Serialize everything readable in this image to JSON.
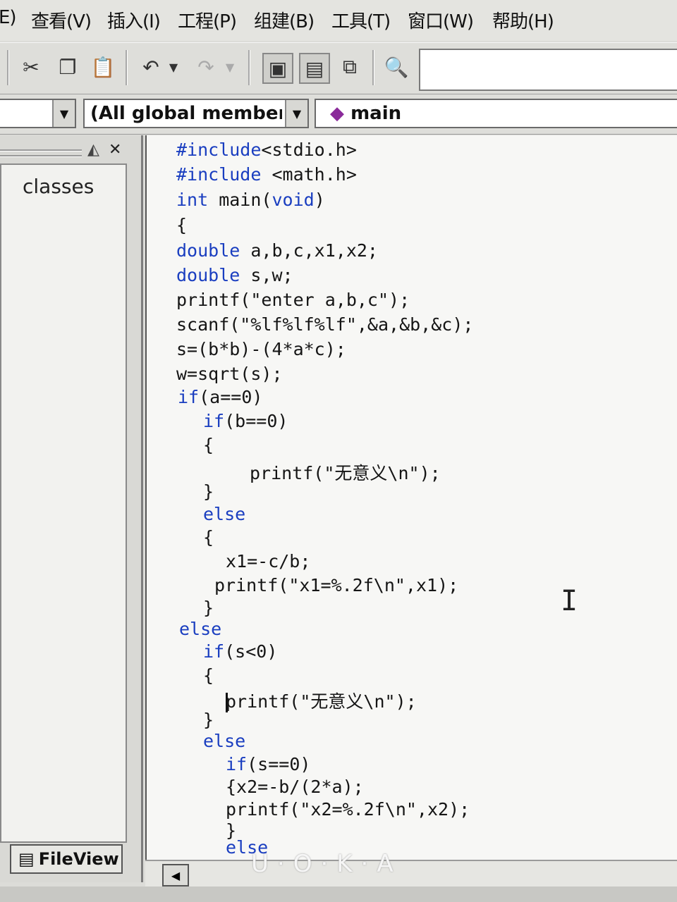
{
  "menu": {
    "items": [
      "E)",
      "查看(V)",
      "插入(I)",
      "工程(P)",
      "组建(B)",
      "工具(T)",
      "窗口(W)",
      "帮助(H)"
    ]
  },
  "toolbar": {
    "icons": [
      "cut-icon",
      "copy-icon",
      "paste-icon",
      "undo-icon",
      "redo-icon",
      "workspace-icon",
      "output-icon",
      "window-list-icon",
      "find-in-files-icon"
    ],
    "search_value": ""
  },
  "wizard_bar": {
    "class_combo": "",
    "members_combo": "(All global members",
    "function_combo": "main"
  },
  "workspace": {
    "tree_item": "classes",
    "tab_label": "FileView"
  },
  "editor": {
    "lines": [
      "#include<stdio.h>",
      "#include <math.h>",
      "int main(void)",
      "{",
      "double a,b,c,x1,x2;",
      "double s,w;",
      "printf(\"enter a,b,c\");",
      "scanf(\"%lf%lf%lf\",&a,&b,&c);",
      "s=(b*b)-(4*a*c);",
      "w=sqrt(s);",
      "if(a==0)",
      "if(b==0)",
      "{",
      "printf(\"无意义\\n\");",
      "}",
      "else",
      "{",
      "x1=-c/b;",
      "printf(\"x1=%.2f\\n\",x1);",
      "}",
      "else",
      "if(s<0)",
      "{",
      "printf(\"无意义\\n\");",
      "}",
      "else",
      "if(s==0)",
      "{x2=-b/(2*a);",
      "printf(\"x2=%.2f\\n\",x2);",
      "}",
      "else"
    ]
  },
  "watermark": "U·O·K·A",
  "colors": {
    "keyword": "#1a3ec0",
    "text": "#151515",
    "editor_bg": "#f7f7f5"
  }
}
